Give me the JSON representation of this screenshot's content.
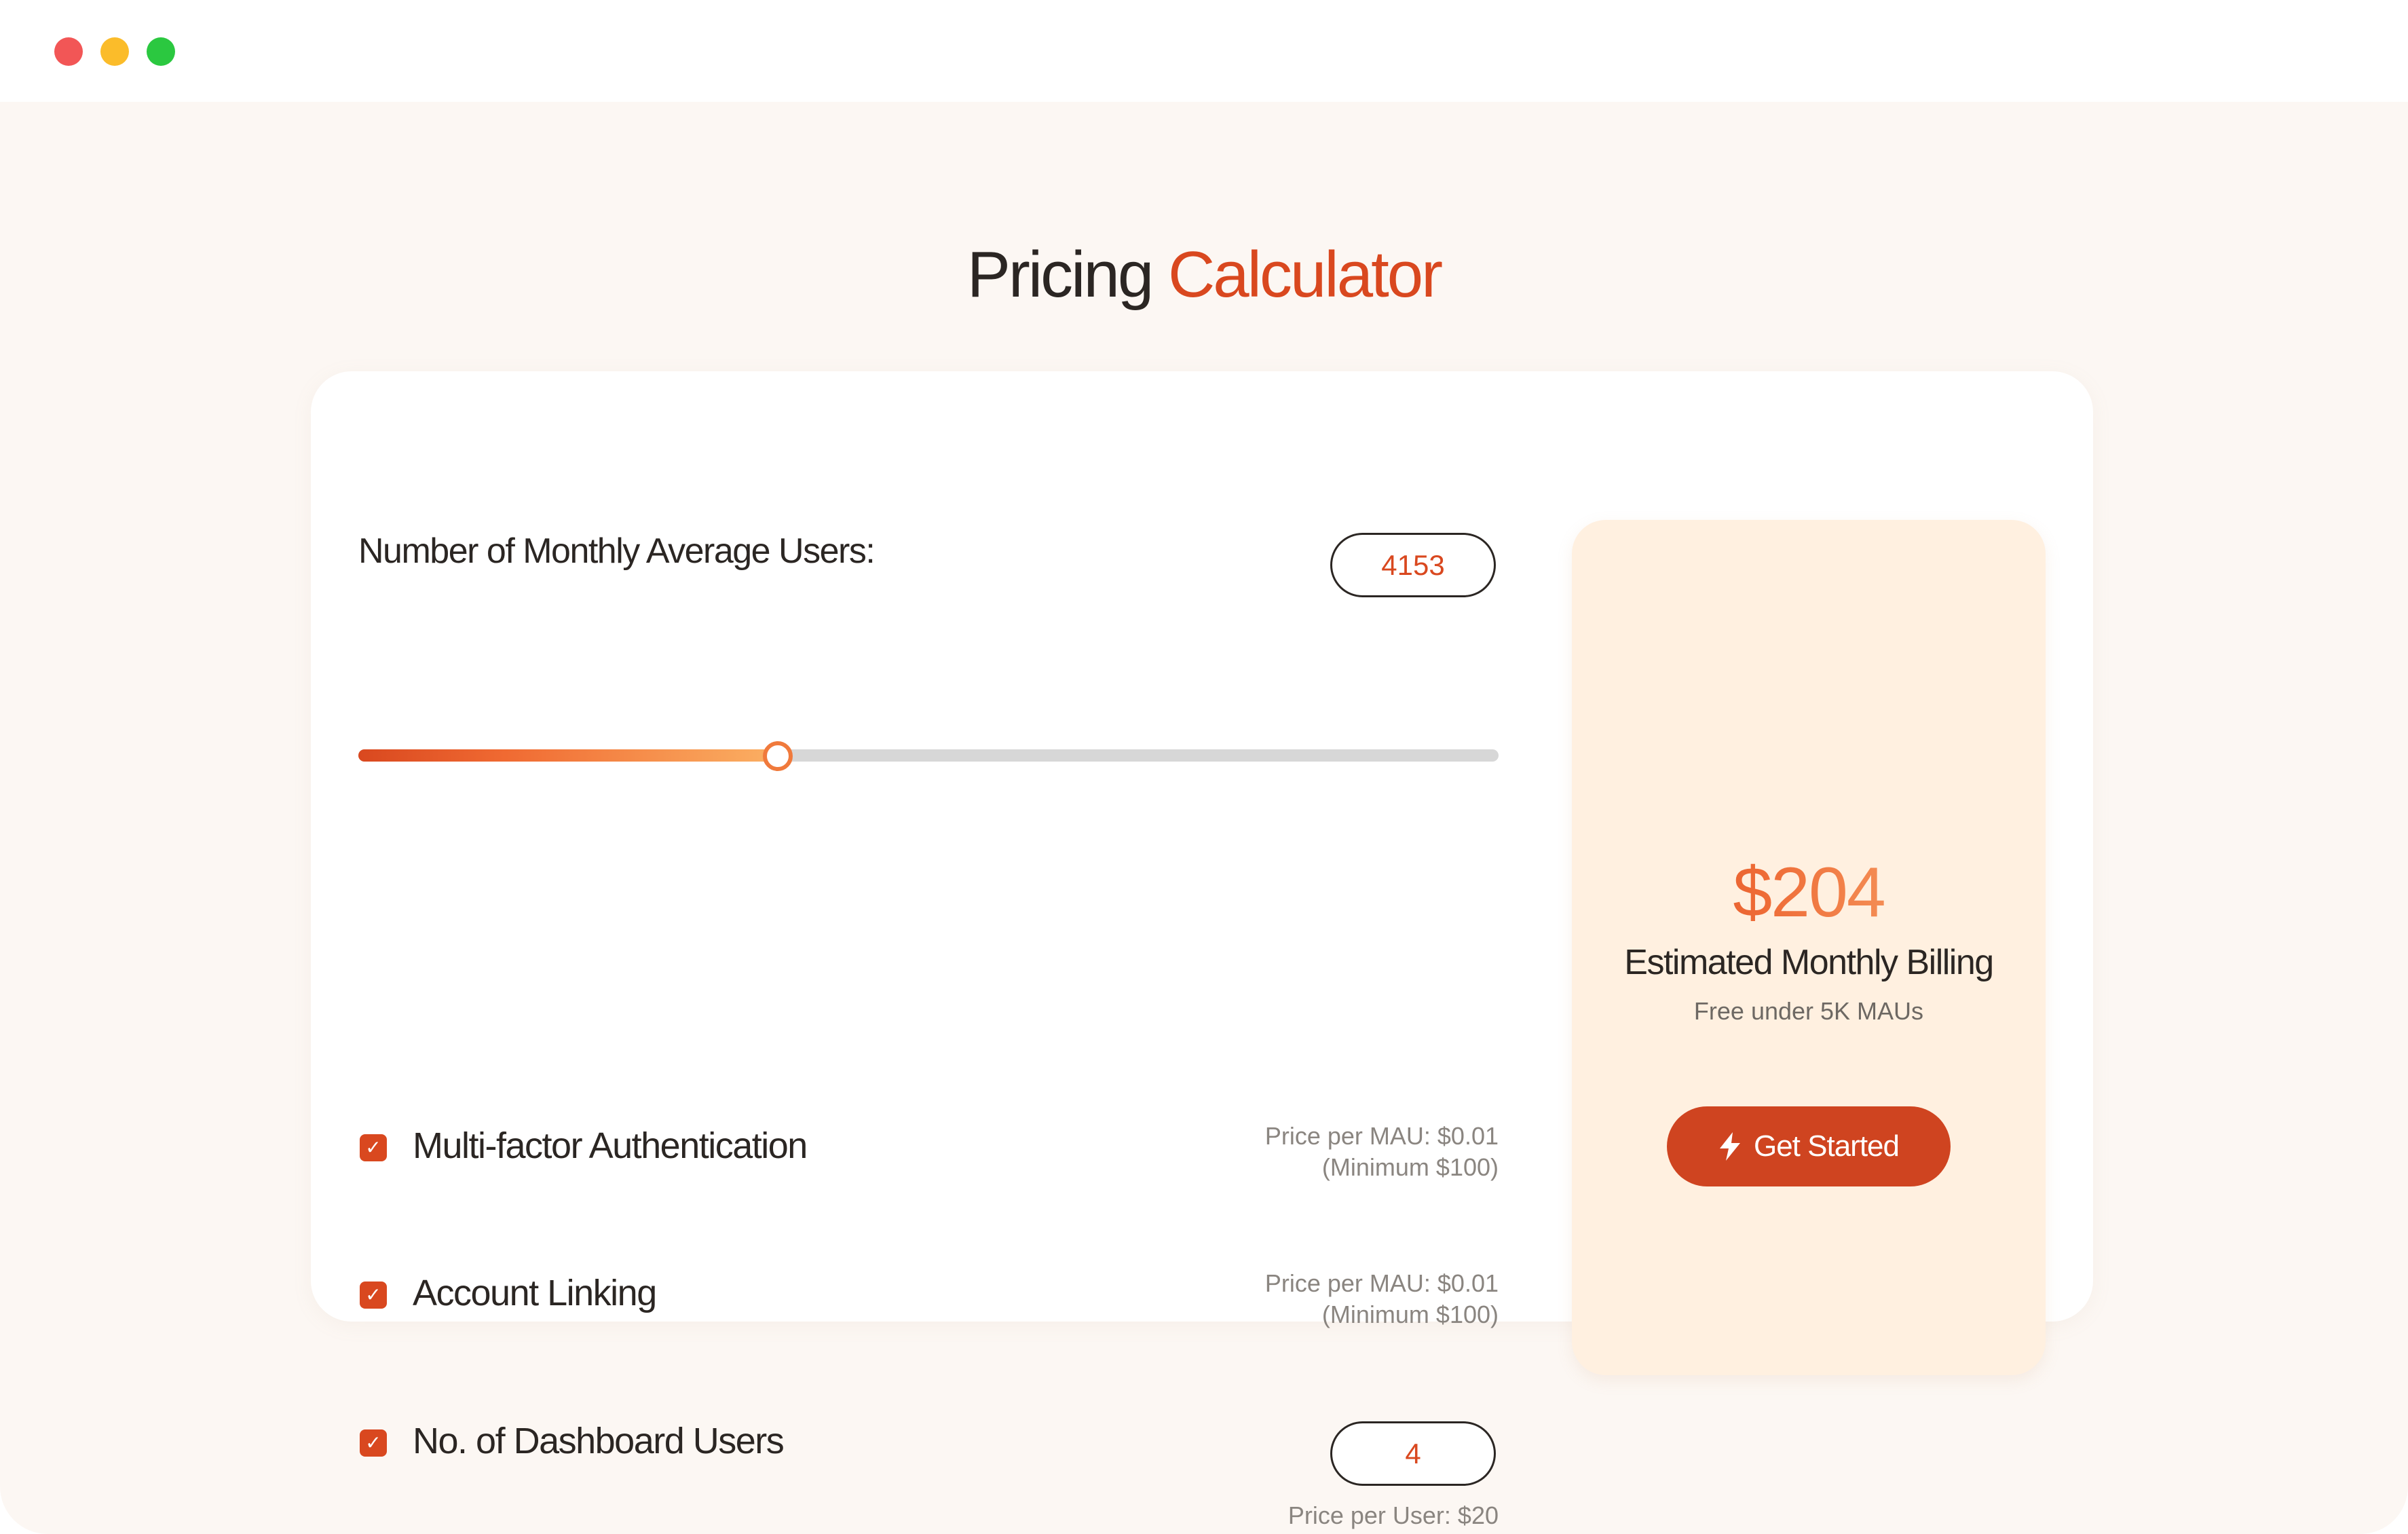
{
  "window": {
    "controls": [
      "close",
      "minimize",
      "maximize"
    ]
  },
  "heading": {
    "part1": "Pricing",
    "part2": "Calculator"
  },
  "calculator": {
    "mau_label": "Number of Monthly Average Users:",
    "mau_value": "4153",
    "slider_fraction": 0.368,
    "options": [
      {
        "label": "Multi-factor Authentication",
        "checked": true,
        "price_line1": "Price per MAU: $0.01",
        "price_line2": "(Minimum $100)"
      },
      {
        "label": "Account Linking",
        "checked": true,
        "price_line1": "Price per MAU: $0.01",
        "price_line2": "(Minimum $100)"
      },
      {
        "label": "No. of Dashboard Users",
        "checked": true
      }
    ],
    "dashboard_users_value": "4",
    "dashboard_price": "Price per User: $20"
  },
  "summary": {
    "amount": "$204",
    "title": "Estimated Monthly Billing",
    "note": "Free under 5K MAUs",
    "cta_label": "Get Started",
    "cta_icon": "lightning-bolt-icon"
  },
  "colors": {
    "accent": "#d9481f",
    "accent_light": "#fbb063",
    "background": "#fcf7f3",
    "summary_bg": "#fff0e0",
    "text": "#2b2623"
  }
}
